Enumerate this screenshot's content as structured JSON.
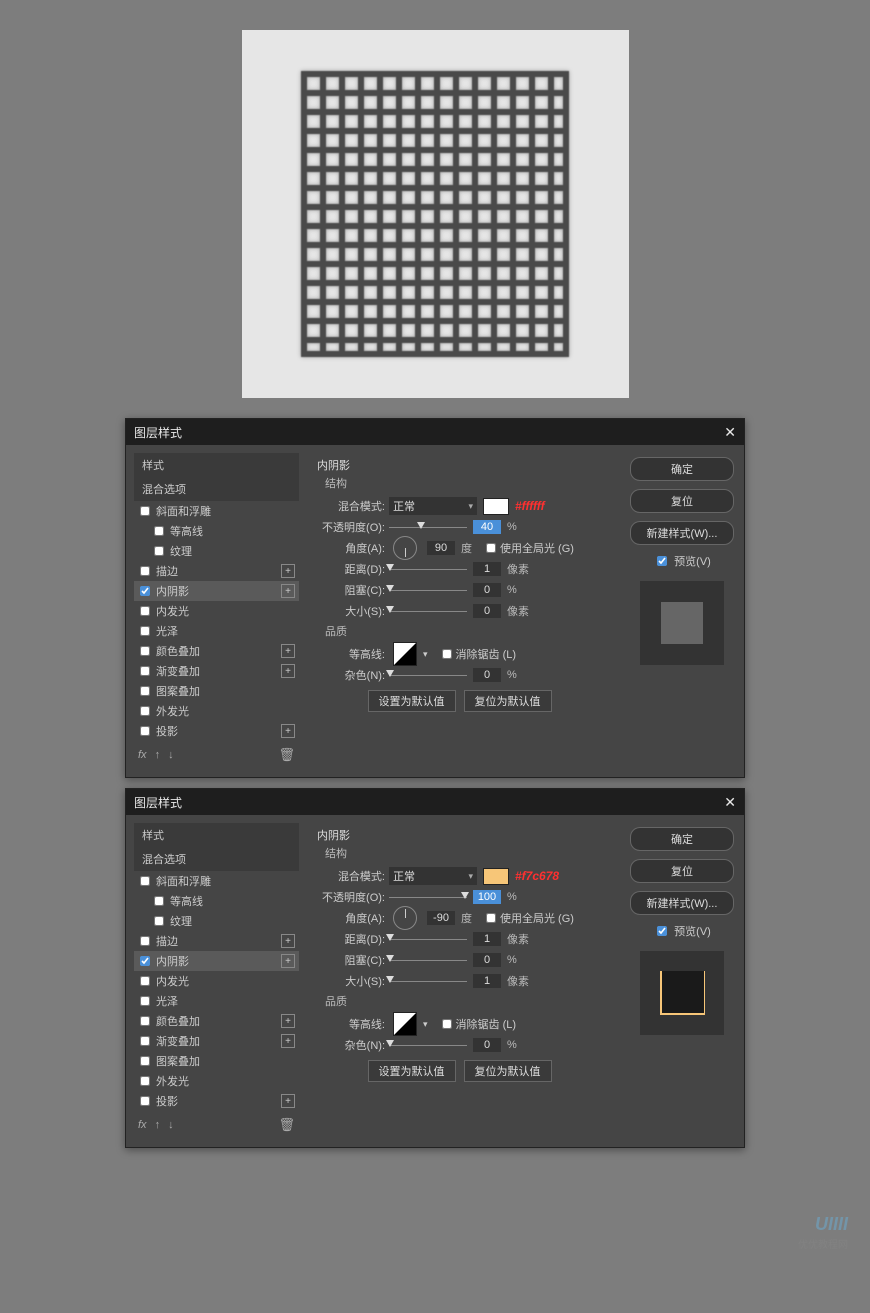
{
  "canvas": {},
  "dialog_title": "图层样式",
  "left": {
    "hdr_styles": "样式",
    "hdr_blend": "混合选项",
    "bevel": "斜面和浮雕",
    "contour": "等高线",
    "texture": "纹理",
    "stroke": "描边",
    "inner_shadow": "内阴影",
    "inner_glow": "内发光",
    "satin": "光泽",
    "color_overlay": "颜色叠加",
    "grad_overlay": "渐变叠加",
    "pat_overlay": "图案叠加",
    "outer_glow": "外发光",
    "drop_shadow": "投影",
    "fx": "fx"
  },
  "mid": {
    "title": "内阴影",
    "struct": "结构",
    "blend_mode": "混合模式:",
    "mode_normal": "正常",
    "opacity": "不透明度(O):",
    "angle": "角度(A):",
    "deg": "度",
    "use_global": "使用全局光 (G)",
    "distance": "距离(D):",
    "choke": "阻塞(C):",
    "size": "大小(S):",
    "quality": "品质",
    "contour_lbl": "等高线:",
    "antialias": "消除锯齿 (L)",
    "noise": "杂色(N):",
    "px": "像素",
    "pct": "%",
    "set_default": "设置为默认值",
    "reset_default": "复位为默认值"
  },
  "right": {
    "ok": "确定",
    "cancel": "复位",
    "new_style": "新建样式(W)...",
    "preview": "预览(V)"
  },
  "d1": {
    "color_hex": "#ffffff",
    "color_label": "#ffffff",
    "opacity": "40",
    "angle": "90",
    "distance": "1",
    "choke": "0",
    "size": "0",
    "noise": "0"
  },
  "d2": {
    "color_hex": "#f7c678",
    "color_label": "#f7c678",
    "opacity": "100",
    "angle": "-90",
    "distance": "1",
    "choke": "0",
    "size": "1",
    "noise": "0"
  },
  "watermark": {
    "main": "UIIII",
    "sub": "优优教程网"
  }
}
